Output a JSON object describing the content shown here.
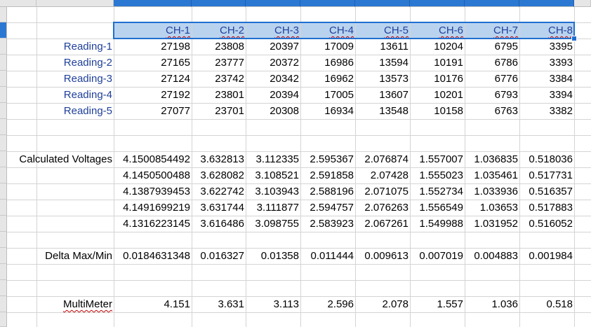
{
  "sheet": {
    "channel_headers": [
      "CH-1",
      "CH-2",
      "CH-3",
      "CH-4",
      "CH-5",
      "CH-6",
      "CH-7",
      "CH-8"
    ],
    "readings": [
      {
        "label": "Reading-1",
        "values": [
          "27198",
          "23808",
          "20397",
          "17009",
          "13611",
          "10204",
          "6795",
          "3395"
        ]
      },
      {
        "label": "Reading-2",
        "values": [
          "27165",
          "23777",
          "20372",
          "16986",
          "13594",
          "10191",
          "6786",
          "3393"
        ]
      },
      {
        "label": "Reading-3",
        "values": [
          "27124",
          "23742",
          "20342",
          "16962",
          "13573",
          "10176",
          "6776",
          "3384"
        ]
      },
      {
        "label": "Reading-4",
        "values": [
          "27192",
          "23801",
          "20394",
          "17005",
          "13607",
          "10201",
          "6793",
          "3394"
        ]
      },
      {
        "label": "Reading-5",
        "values": [
          "27077",
          "23701",
          "20308",
          "16934",
          "13548",
          "10158",
          "6763",
          "3382"
        ]
      }
    ],
    "calc_label": "Calculated Voltages",
    "calc_rows": [
      [
        "4.1500854492",
        "3.632813",
        "3.112335",
        "2.595367",
        "2.076874",
        "1.557007",
        "1.036835",
        "0.518036"
      ],
      [
        "4.1450500488",
        "3.628082",
        "3.108521",
        "2.591858",
        "2.07428",
        "1.555023",
        "1.035461",
        "0.517731"
      ],
      [
        "4.1387939453",
        "3.622742",
        "3.103943",
        "2.588196",
        "2.071075",
        "1.552734",
        "1.033936",
        "0.516357"
      ],
      [
        "4.1491699219",
        "3.631744",
        "3.111877",
        "2.594757",
        "2.076263",
        "1.556549",
        "1.03653",
        "0.517883"
      ],
      [
        "4.1316223145",
        "3.616486",
        "3.098755",
        "2.583923",
        "2.067261",
        "1.549988",
        "1.031952",
        "0.516052"
      ]
    ],
    "delta_label": "Delta Max/Min",
    "delta_values": [
      "0.0184631348",
      "0.016327",
      "0.01358",
      "0.011444",
      "0.009613",
      "0.007019",
      "0.004883",
      "0.001984"
    ],
    "multimeter_label": "MultiMeter",
    "multimeter_values": [
      "4.151",
      "3.631",
      "3.113",
      "2.596",
      "2.078",
      "1.557",
      "1.036",
      "0.518"
    ]
  },
  "colors": {
    "selection_border": "#1f6fd0",
    "selected_header": "#2b78d3",
    "selection_fill": "#b9d3ef",
    "header_text": "#1f3f9a"
  }
}
